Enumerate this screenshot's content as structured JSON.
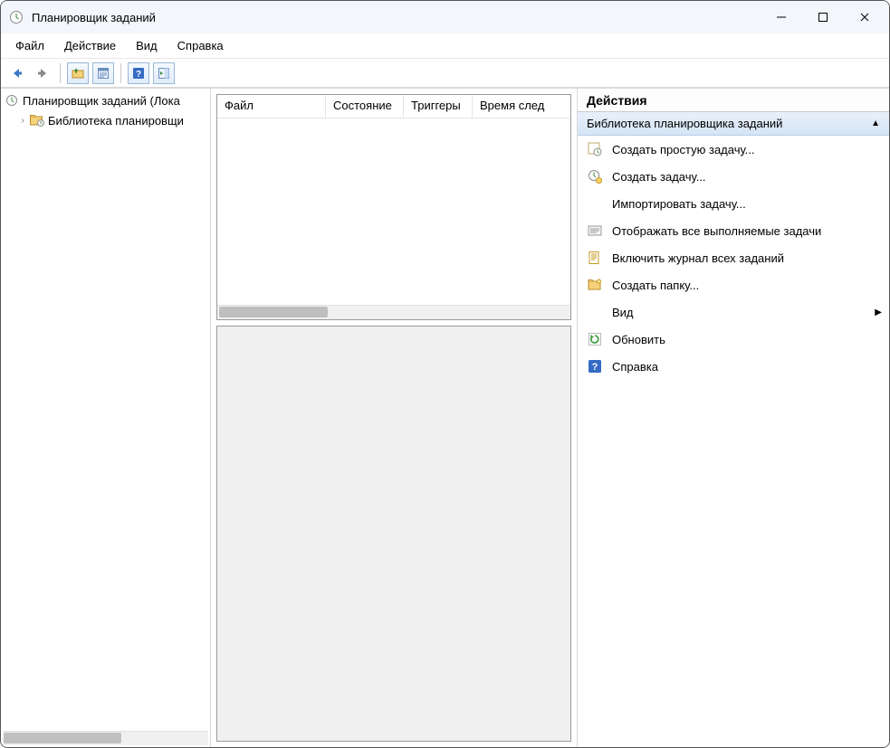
{
  "window": {
    "title": "Планировщик заданий"
  },
  "menubar": {
    "file": "Файл",
    "action": "Действие",
    "view": "Вид",
    "help": "Справка"
  },
  "tree": {
    "root": "Планировщик заданий (Лока",
    "library": "Библиотека планировщи"
  },
  "list": {
    "columns": {
      "file": "Файл",
      "state": "Состояние",
      "triggers": "Триггеры",
      "next_run": "Время след"
    }
  },
  "actions_panel": {
    "title": "Действия",
    "group_header": "Библиотека планировщика заданий",
    "items": {
      "create_basic": "Создать простую задачу...",
      "create_task": "Создать задачу...",
      "import_task": "Импортировать задачу...",
      "show_running": "Отображать все выполняемые задачи",
      "enable_history": "Включить журнал всех заданий",
      "new_folder": "Создать папку...",
      "view": "Вид",
      "refresh": "Обновить",
      "help": "Справка"
    }
  }
}
